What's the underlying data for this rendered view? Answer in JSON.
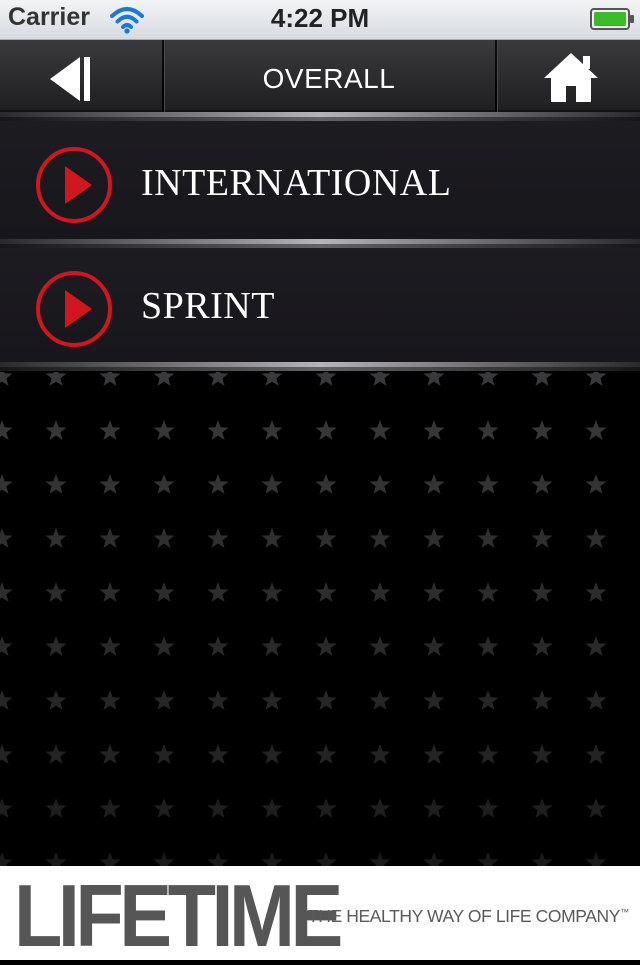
{
  "status_bar": {
    "carrier": "Carrier",
    "time": "4:22 PM",
    "wifi_icon": "wifi-icon",
    "battery_icon": "battery-icon",
    "battery_color": "#3cbb2a"
  },
  "nav": {
    "title": "OVERALL",
    "back_icon": "back-arrow-icon",
    "home_icon": "home-icon"
  },
  "list": {
    "items": [
      {
        "label": "INTERNATIONAL",
        "icon": "play-icon"
      },
      {
        "label": "SPRINT",
        "icon": "play-icon"
      }
    ]
  },
  "colors": {
    "accent_red": "#d3151d",
    "row_background": "#1b1a1f"
  },
  "footer": {
    "logo": "LIFETIME",
    "tagline": "THE HEALTHY WAY OF LIFE COMPANY",
    "trademark": "™"
  }
}
